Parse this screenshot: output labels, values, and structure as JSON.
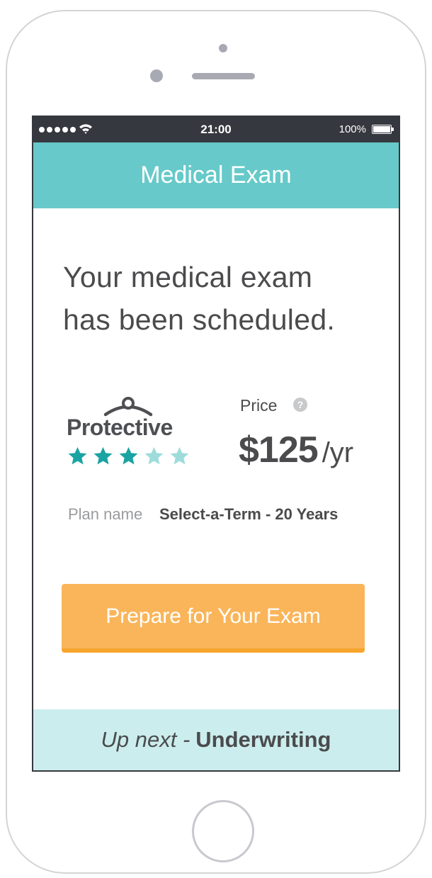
{
  "status_bar": {
    "time": "21:00",
    "battery_percent": "100%",
    "signal_bars": 5
  },
  "header": {
    "title": "Medical Exam",
    "background": "#67c9c9"
  },
  "confirmation": {
    "headline_line1": "Your medical exam",
    "headline_line2": "has been scheduled."
  },
  "insurer": {
    "name": "Protective",
    "rating": 3,
    "rating_max": 5,
    "star_color_filled": "#1aa3a3",
    "star_color_empty": "#9edcdc"
  },
  "price": {
    "label": "Price",
    "help_icon": "question-circle-icon",
    "help_glyph": "?",
    "amount": "$125",
    "period": "/yr"
  },
  "plan": {
    "label": "Plan name",
    "value": "Select-a-Term - 20 Years"
  },
  "cta": {
    "label": "Prepare for Your Exam",
    "color": "#fab55a"
  },
  "up_next": {
    "prefix": "Up next -",
    "step": "Underwriting"
  }
}
